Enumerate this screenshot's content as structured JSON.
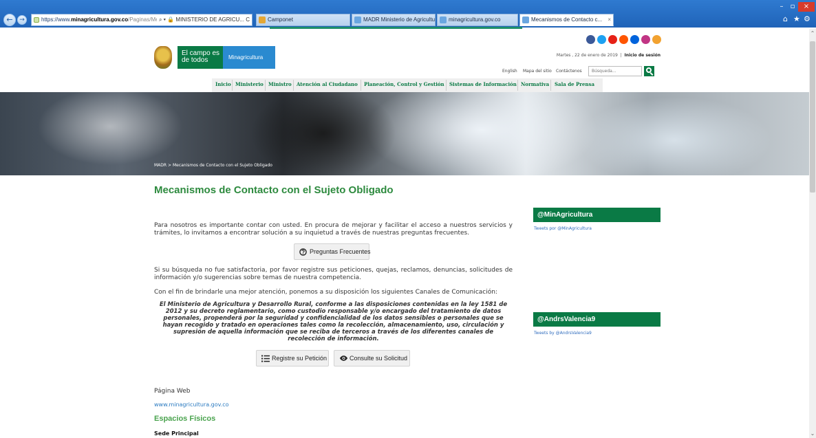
{
  "browser": {
    "address": {
      "scheme": "https://www.",
      "host": "minagricultura.gov.co",
      "path": "/Paginas/Mecanismos",
      "controls": "⌕ ▾ 🔒 MINISTERIO DE AGRICU... C"
    },
    "tabs": [
      {
        "label": "Camponet"
      },
      {
        "label": "MADR Ministerio de Agricultur..."
      },
      {
        "label": "minagricultura.gov.co"
      },
      {
        "label": "Mecanismos de Contacto c...",
        "close": "×"
      }
    ],
    "window_controls": {
      "min": "–",
      "max": "▫",
      "close": "×"
    },
    "toolbar_icons": {
      "home": "⌂",
      "favorites": "★",
      "tools": "⚙"
    }
  },
  "site": {
    "logo": {
      "tagline": "El campo es de todos",
      "brand": "Minagricultura"
    },
    "social_icons": [
      {
        "name": "facebook-icon",
        "color": "#3b5998"
      },
      {
        "name": "twitter-icon",
        "color": "#1da1f2"
      },
      {
        "name": "youtube-icon",
        "color": "#e62117"
      },
      {
        "name": "soundcloud-icon",
        "color": "#ff5500"
      },
      {
        "name": "flickr-icon",
        "color": "#0063dc"
      },
      {
        "name": "instagram-icon",
        "color": "#c13584"
      },
      {
        "name": "rss-icon",
        "color": "#f2a230"
      }
    ],
    "date_text": "Martes , 22 de enero de 2019",
    "login": "Inicio de sesión",
    "util_links": {
      "english": "English",
      "sitemap": "Mapa del sitio",
      "contact": "Contáctenos"
    },
    "search_placeholder": "Búsqueda...",
    "menu": [
      {
        "id": "inicio",
        "label": "Inicio"
      },
      {
        "id": "ministerio",
        "label": "Ministerio"
      },
      {
        "id": "ministro",
        "label": "Ministro"
      },
      {
        "id": "atencion",
        "label": "Atención al Ciudadano"
      },
      {
        "id": "planeacion",
        "label": "Planeación, Control y Gestión"
      },
      {
        "id": "sistemas",
        "label": "Sistemas de Información"
      },
      {
        "id": "normativa",
        "label": "Normativa"
      },
      {
        "id": "prensa",
        "label": "Sala de Prensa"
      }
    ],
    "breadcrumb": {
      "home": "MADR",
      "separator": ">",
      "current": "Mecanismos de Contacto con el Sujeto Obligado"
    }
  },
  "main": {
    "title": "Mecanismos de Contacto con el Sujeto Obligado",
    "intro": "Para nosotros es importante contar con usted. En procura de mejorar y facilitar el acceso a nuestros servicios y trámites, lo invitamos a encontrar solución a su inquietud a través de nuestras preguntas frecuentes.",
    "faq_button": "Preguntas Frecuentes",
    "search_fail": "Si su búsqueda no fue satisfactoria, por favor registre sus peticiones, quejas, reclamos, denuncias, solicitudes de información y/o sugerencias sobre temas de nuestra competencia.",
    "canals": "Con el fin de brindarle una mejor atención, ponemos a su disposición los siguientes Canales de Comunicación:",
    "legal": "El Ministerio de Agricultura y Desarrollo Rural, conforme a las disposiciones contenidas en la ley 1581 de 2012 y su decreto reglamentario, como custodio responsable y/o encargado del tratamiento de datos personales, propenderá por la seguridad y confidencialidad de los datos sensibles o personales que se hayan recogido y tratado en operaciones tales como la recolección, almacenamiento, uso, circulación y supresión de aquella información que se reciba de terceros a través de los diferentes canales de recolección de información.",
    "register_button": "Registre su Petición",
    "consult_button": "Consulte su Solicitud",
    "pagina_web_label": "Página Web",
    "pagina_web_link": "www.minagricultura.gov.co",
    "espacios_title": "Espacios Físicos",
    "sede_principal": "Sede Principal"
  },
  "sidebar": {
    "twitter1": {
      "header": "@MinAgricultura",
      "sub": "Tweets por @MinAgricultura"
    },
    "twitter2": {
      "header": "@AndrsValencia9",
      "sub": "Tweets by @AndrsValencia9"
    }
  },
  "colors": {
    "brand_green": "#0a7a45",
    "title_green": "#2d8a3e",
    "brand_blue": "#2a8ad0",
    "link_blue": "#2a7ac0"
  }
}
